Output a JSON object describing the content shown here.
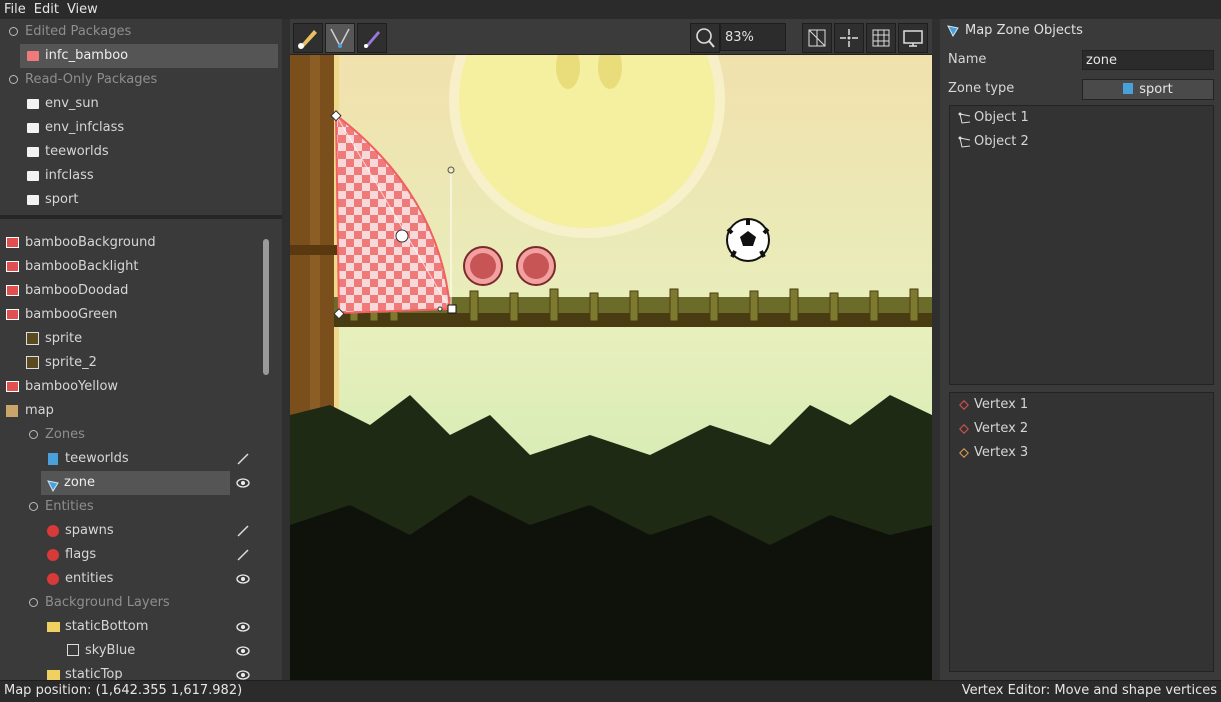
{
  "menu": [
    "File",
    "Edit",
    "View"
  ],
  "packages": {
    "edited_header": "Edited Packages",
    "edited": [
      "infc_bamboo"
    ],
    "readonly_header": "Read-Only Packages",
    "readonly": [
      "env_sun",
      "env_infclass",
      "teeworlds",
      "infclass",
      "sport"
    ]
  },
  "tree": {
    "items": [
      {
        "label": "bambooBackground"
      },
      {
        "label": "bambooBacklight"
      },
      {
        "label": "bambooDoodad"
      },
      {
        "label": "bambooGreen"
      },
      {
        "label": "sprite"
      },
      {
        "label": "sprite_2"
      },
      {
        "label": "bambooYellow"
      },
      {
        "label": "map"
      },
      {
        "label": "Zones"
      },
      {
        "label": "teeworlds"
      },
      {
        "label": "zone"
      },
      {
        "label": "Entities"
      },
      {
        "label": "spawns"
      },
      {
        "label": "flags"
      },
      {
        "label": "entities"
      },
      {
        "label": "Background Layers"
      },
      {
        "label": "staticBottom"
      },
      {
        "label": "skyBlue"
      },
      {
        "label": "staticTop"
      }
    ]
  },
  "toolbar": {
    "zoom": "83%",
    "tools": [
      "vertex-editor-icon",
      "zone-edit-icon",
      "brush-icon"
    ],
    "right_tools": [
      "map-icon",
      "crosshair-icon",
      "grid-icon",
      "screen-icon"
    ]
  },
  "right_panel": {
    "title": "Map Zone Objects",
    "name_label": "Name",
    "name_value": "zone",
    "zone_type_label": "Zone type",
    "zone_type_value": "sport",
    "objects": [
      "Object 1",
      "Object 2"
    ],
    "vertices": [
      "Vertex 1",
      "Vertex 2",
      "Vertex 3"
    ]
  },
  "status": {
    "left": "Map position: (1,642.355   1,617.982)",
    "right": "Vertex Editor: Move and shape vertices"
  },
  "colors": {
    "accent": "#4aa0d8",
    "zone_fill": "#f07a7a",
    "selected_bg": "#555555"
  }
}
